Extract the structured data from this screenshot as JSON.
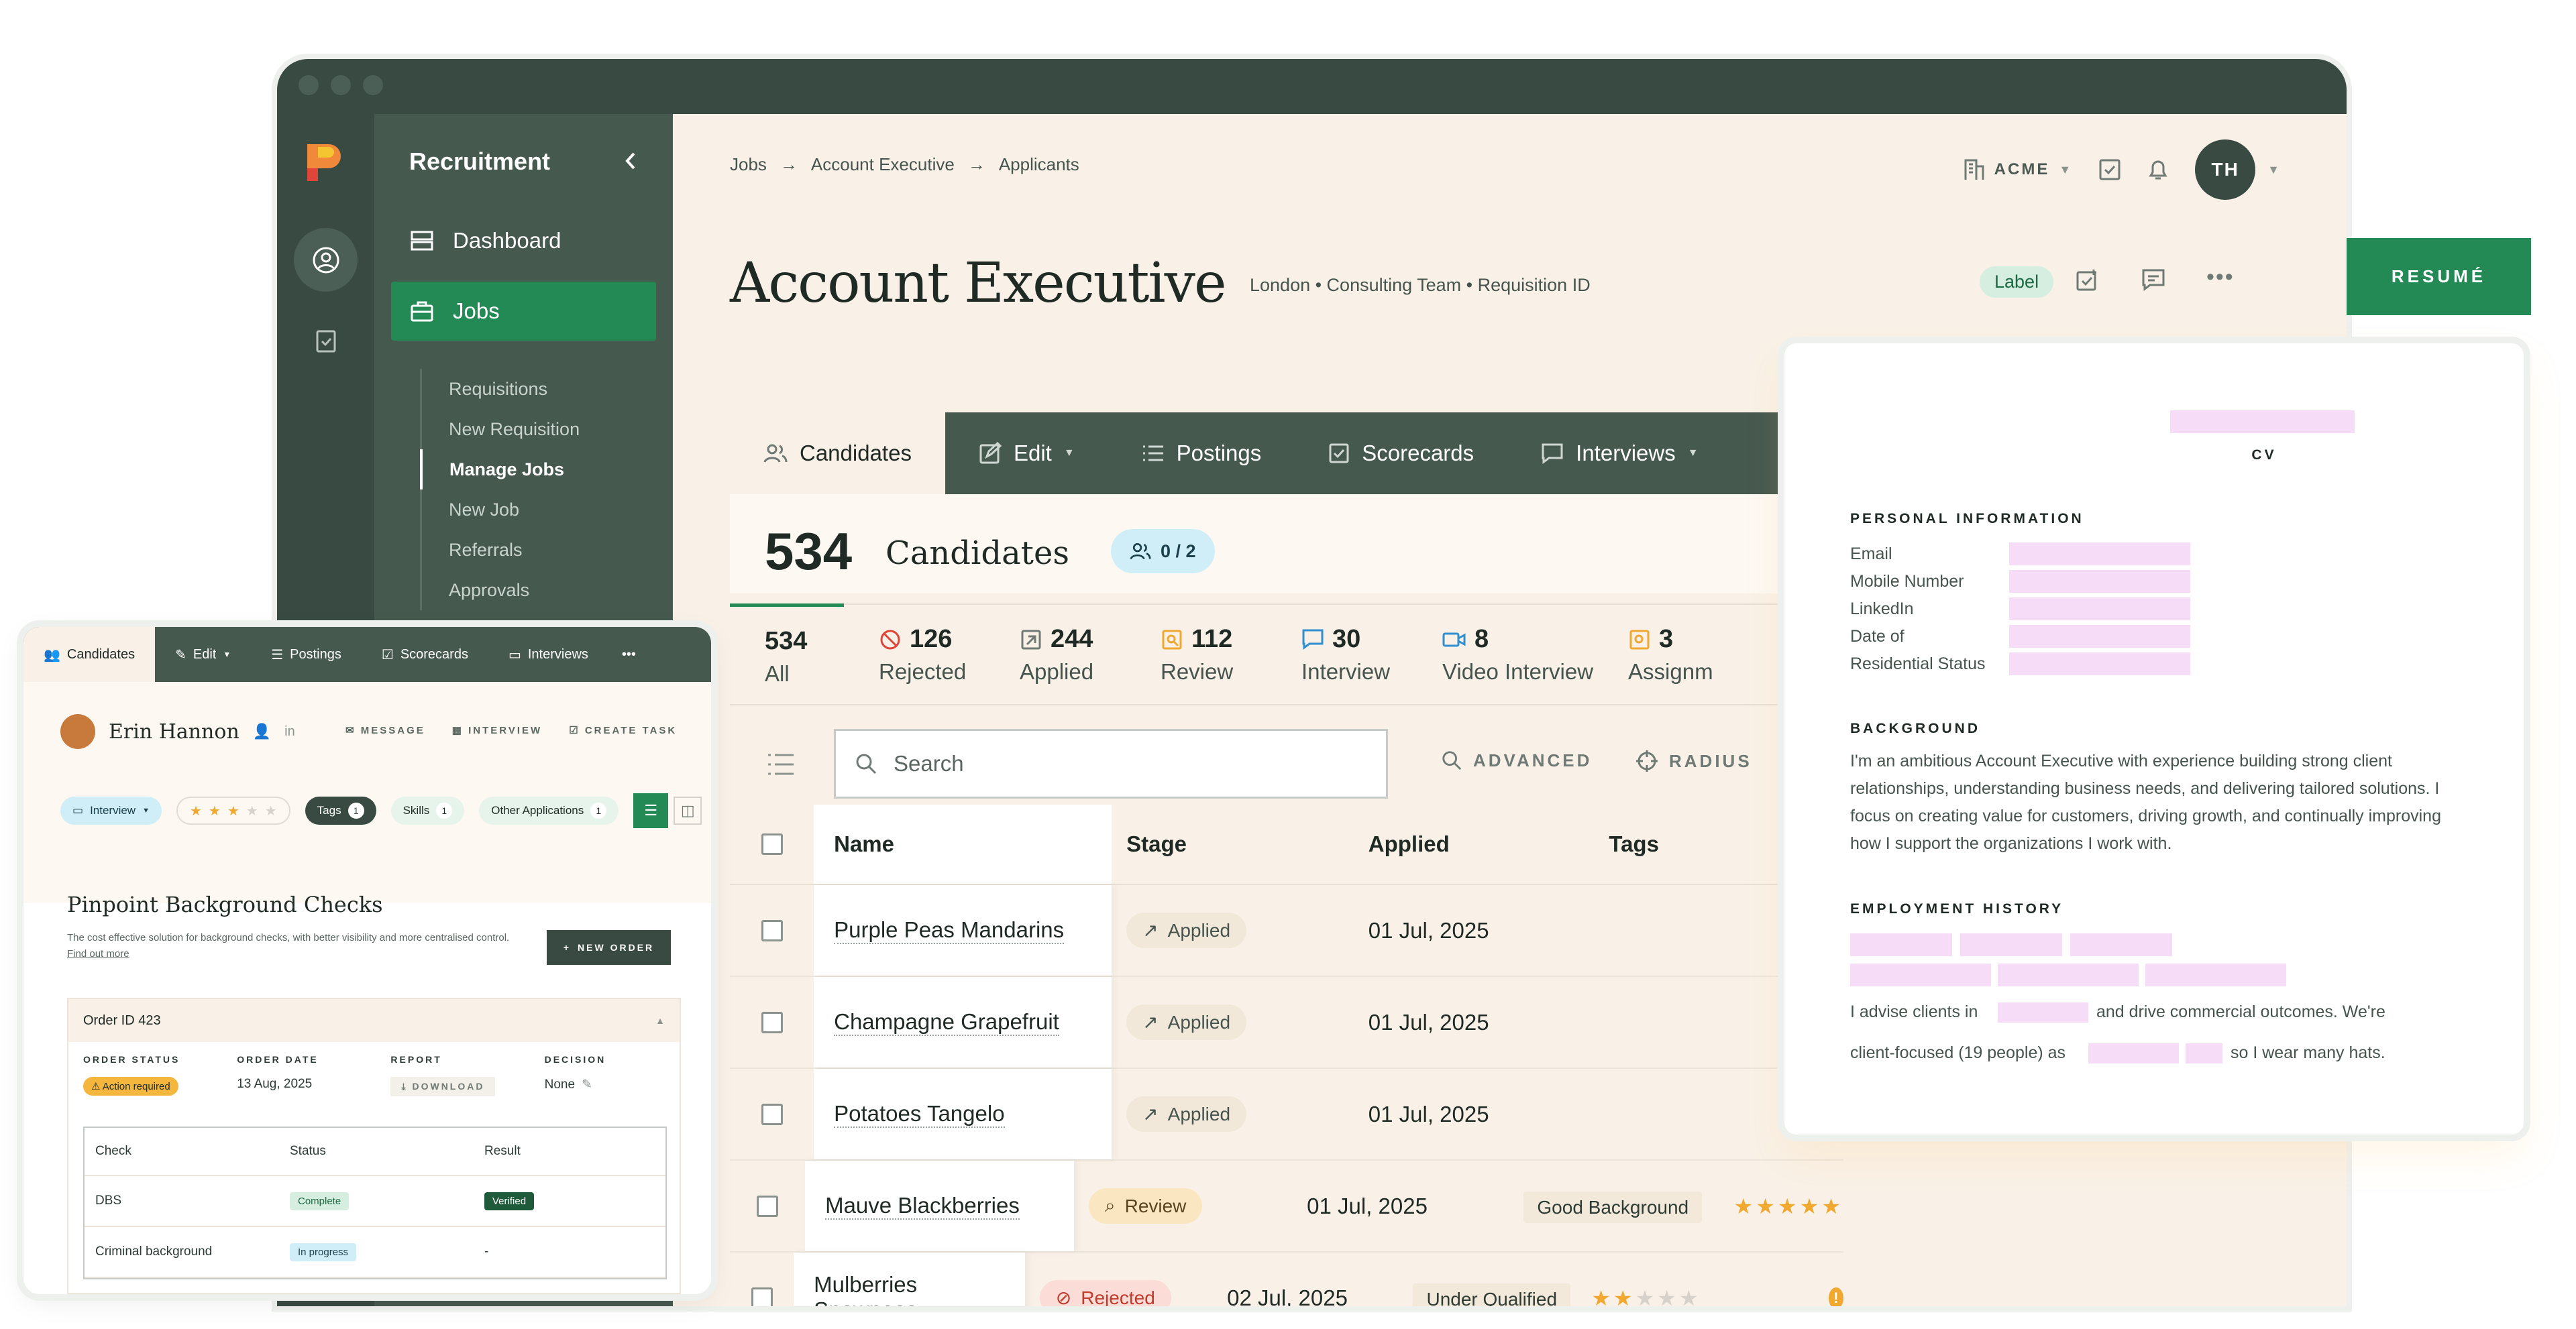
{
  "sidebar": {
    "title": "Recruitment",
    "items": [
      {
        "label": "Dashboard"
      },
      {
        "label": "Jobs"
      }
    ],
    "subitems": [
      "Requisitions",
      "New Requisition",
      "Manage Jobs",
      "New Job",
      "Referrals",
      "Approvals"
    ]
  },
  "breadcrumb": [
    "Jobs",
    "Account Executive",
    "Applicants"
  ],
  "org": "ACME",
  "avatar": "TH",
  "job": {
    "title": "Account Executive",
    "meta": "London • Consulting Team • Requisition ID",
    "label": "Label"
  },
  "tabs": [
    "Candidates",
    "Edit",
    "Postings",
    "Scorecards",
    "Interviews"
  ],
  "candidates": {
    "count": "534",
    "label": "Candidates",
    "selected": "0 / 2"
  },
  "stats": [
    {
      "n": "534",
      "l": "All"
    },
    {
      "n": "126",
      "l": "Rejected",
      "color": "#e0453a"
    },
    {
      "n": "244",
      "l": "Applied",
      "color": "#6f7a75"
    },
    {
      "n": "112",
      "l": "Review",
      "color": "#f0a830"
    },
    {
      "n": "30",
      "l": "Interview",
      "color": "#2f8fd0"
    },
    {
      "n": "8",
      "l": "Video Interview",
      "color": "#2f8fd0"
    },
    {
      "n": "3",
      "l": "Assignm",
      "color": "#f0a830"
    }
  ],
  "search": {
    "placeholder": "Search",
    "advanced": "ADVANCED",
    "radius": "RADIUS"
  },
  "table": {
    "headers": [
      "Name",
      "Stage",
      "Applied",
      "Tags"
    ],
    "rows": [
      {
        "name": "Purple Peas Mandarins",
        "stage": "Applied",
        "applied": "01 Jul, 2025",
        "tag": "",
        "stars": 0
      },
      {
        "name": "Champagne Grapefruit",
        "stage": "Applied",
        "applied": "01 Jul, 2025",
        "tag": "",
        "stars": 0
      },
      {
        "name": "Potatoes Tangelo",
        "stage": "Applied",
        "applied": "01 Jul, 2025",
        "tag": "",
        "stars": 0
      },
      {
        "name": "Mauve Blackberries",
        "stage": "Review",
        "applied": "01 Jul, 2025",
        "tag": "Good Background",
        "stars": 4.5
      },
      {
        "name": "Mulberries Snowpeas",
        "stage": "Rejected",
        "applied": "02 Jul, 2025",
        "tag": "Under Qualified",
        "stars": 2
      }
    ]
  },
  "card": {
    "tabs": [
      "Candidates",
      "Edit",
      "Postings",
      "Scorecards",
      "Interviews"
    ],
    "name": "Erin Hannon",
    "actions": [
      "MESSAGE",
      "INTERVIEW",
      "CREATE TASK"
    ],
    "chips": {
      "stage": "Interview",
      "tags": "Tags",
      "tags_count": "1",
      "skills": "Skills",
      "skills_count": "1",
      "other": "Other Applications",
      "other_count": "1"
    },
    "rating": 3,
    "bg_title": "Pinpoint Background Checks",
    "bg_sub": "The cost effective solution for background checks, with better visibility and more centralised control.",
    "bg_link": "Find out more",
    "new_order": "NEW ORDER",
    "order": {
      "id": "Order ID 423",
      "cols": [
        {
          "k": "ORDER STATUS",
          "v": "Action required"
        },
        {
          "k": "ORDER DATE",
          "v": "13 Aug, 2025"
        },
        {
          "k": "REPORT",
          "v": "DOWNLOAD"
        },
        {
          "k": "DECISION",
          "v": "None"
        }
      ],
      "table_headers": [
        "Check",
        "Status",
        "Result"
      ],
      "rows": [
        {
          "check": "DBS",
          "status": "Complete",
          "result": "Verified"
        },
        {
          "check": "Criminal background",
          "status": "In progress",
          "result": "-"
        }
      ]
    }
  },
  "resume_button": "RESUMÉ",
  "cv": {
    "title": "CV",
    "personal_heading": "PERSONAL INFORMATION",
    "fields": [
      "Email",
      "Mobile Number",
      "LinkedIn",
      "Date of",
      "Residential Status"
    ],
    "background_heading": "BACKGROUND",
    "background_text": "I'm an ambitious Account Executive with experience building strong client relationships, understanding business needs, and delivering tailored solutions. I focus on creating value for customers, driving growth, and continually improving how I support the organizations I work with.",
    "employment_heading": "EMPLOYMENT HISTORY",
    "line1a": "I advise clients in",
    "line1b": "and drive commercial outcomes. We're",
    "line2a": "client-focused (19 people) as",
    "line2b": "so I wear many hats."
  },
  "colors": {
    "dark_green": "#384a42",
    "accent_green": "#238a56",
    "cream": "#f9f1e7",
    "cv_placeholder": "#f7dcf7"
  }
}
